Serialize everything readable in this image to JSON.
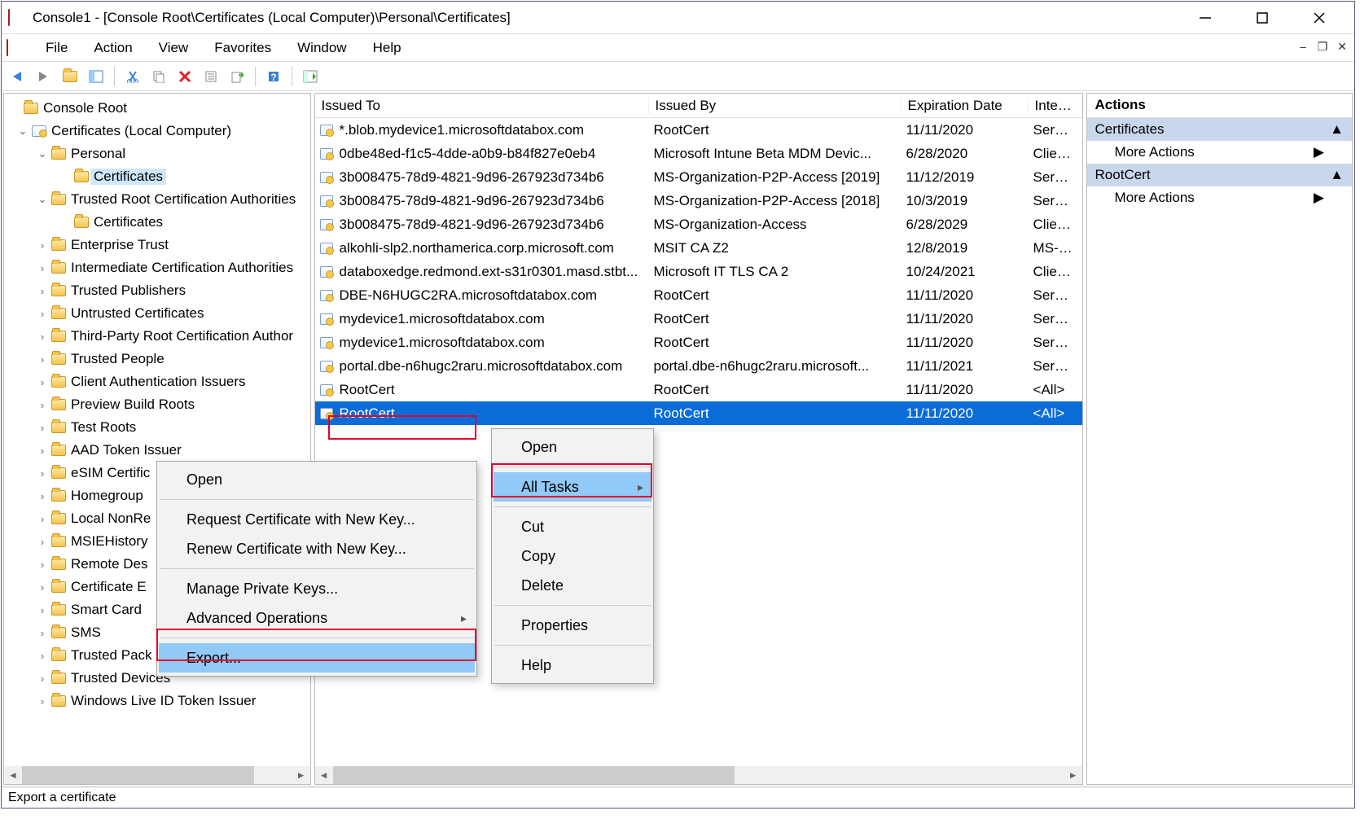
{
  "window": {
    "title": "Console1 - [Console Root\\Certificates (Local Computer)\\Personal\\Certificates]"
  },
  "menu": [
    "File",
    "Action",
    "View",
    "Favorites",
    "Window",
    "Help"
  ],
  "tree": {
    "root": "Console Root",
    "snapin": "Certificates (Local Computer)",
    "personal": "Personal",
    "personal_certs": "Certificates",
    "trca": "Trusted Root Certification Authorities",
    "trca_certs": "Certificates",
    "items": [
      "Enterprise Trust",
      "Intermediate Certification Authorities",
      "Trusted Publishers",
      "Untrusted Certificates",
      "Third-Party Root Certification Author",
      "Trusted People",
      "Client Authentication Issuers",
      "Preview Build Roots",
      "Test Roots",
      "AAD Token Issuer",
      "eSIM Certific",
      "Homegroup",
      "Local NonRe",
      "MSIEHistory",
      "Remote Des",
      "Certificate E",
      "Smart Card",
      "SMS",
      "Trusted Pack",
      "Trusted Devices",
      "Windows Live ID Token Issuer"
    ]
  },
  "columns": {
    "to": "Issued To",
    "by": "Issued By",
    "exp": "Expiration Date",
    "int": "Intende"
  },
  "rows": [
    {
      "to": "*.blob.mydevice1.microsoftdatabox.com",
      "by": "RootCert",
      "exp": "11/11/2020",
      "int": "Server A"
    },
    {
      "to": "0dbe48ed-f1c5-4dde-a0b9-b84f827e0eb4",
      "by": "Microsoft Intune Beta MDM Devic...",
      "exp": "6/28/2020",
      "int": "Client A"
    },
    {
      "to": "3b008475-78d9-4821-9d96-267923d734b6",
      "by": "MS-Organization-P2P-Access [2019]",
      "exp": "11/12/2019",
      "int": "Server A"
    },
    {
      "to": "3b008475-78d9-4821-9d96-267923d734b6",
      "by": "MS-Organization-P2P-Access [2018]",
      "exp": "10/3/2019",
      "int": "Server A"
    },
    {
      "to": "3b008475-78d9-4821-9d96-267923d734b6",
      "by": "MS-Organization-Access",
      "exp": "6/28/2029",
      "int": "Client A"
    },
    {
      "to": "alkohli-slp2.northamerica.corp.microsoft.com",
      "by": "MSIT CA Z2",
      "exp": "12/8/2019",
      "int": "MS-WiF"
    },
    {
      "to": "databoxedge.redmond.ext-s31r0301.masd.stbt...",
      "by": "Microsoft IT TLS CA 2",
      "exp": "10/24/2021",
      "int": "Client A"
    },
    {
      "to": "DBE-N6HUGC2RA.microsoftdatabox.com",
      "by": "RootCert",
      "exp": "11/11/2020",
      "int": "Server A"
    },
    {
      "to": "mydevice1.microsoftdatabox.com",
      "by": "RootCert",
      "exp": "11/11/2020",
      "int": "Server A"
    },
    {
      "to": "mydevice1.microsoftdatabox.com",
      "by": "RootCert",
      "exp": "11/11/2020",
      "int": "Server A"
    },
    {
      "to": "portal.dbe-n6hugc2raru.microsoftdatabox.com",
      "by": "portal.dbe-n6hugc2raru.microsoft...",
      "exp": "11/11/2021",
      "int": "Server A"
    },
    {
      "to": "RootCert",
      "by": "RootCert",
      "exp": "11/11/2020",
      "int": "<All>"
    },
    {
      "to": "RootCert",
      "by": "RootCert",
      "exp": "11/11/2020",
      "int": "<All>",
      "selected": true,
      "redbox": true
    }
  ],
  "actions": {
    "title": "Actions",
    "group1": "Certificates",
    "more": "More Actions",
    "group2": "RootCert"
  },
  "ctx1": {
    "open": "Open",
    "alltasks": "All Tasks",
    "cut": "Cut",
    "copy": "Copy",
    "delete": "Delete",
    "props": "Properties",
    "help": "Help"
  },
  "ctx2": {
    "open": "Open",
    "req": "Request Certificate with New Key...",
    "renew": "Renew Certificate with New Key...",
    "mpk": "Manage Private Keys...",
    "adv": "Advanced Operations",
    "export": "Export..."
  },
  "status": "Export a certificate"
}
